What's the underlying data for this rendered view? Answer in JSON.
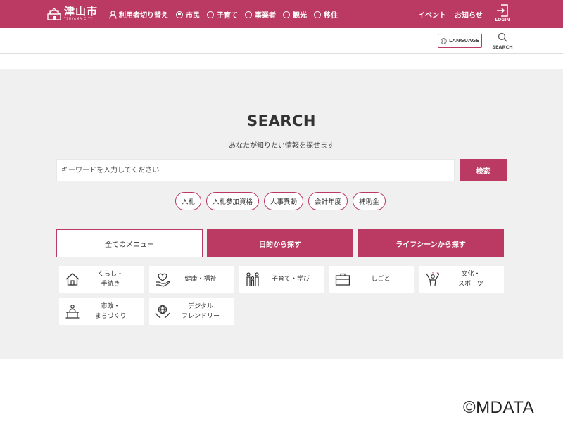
{
  "header": {
    "logo_text": "津山市",
    "logo_sub": "TSUYAMA CITY",
    "user_switch_label": "利用者切り替え",
    "user_types": [
      {
        "label": "市民",
        "checked": true
      },
      {
        "label": "子育て",
        "checked": false
      },
      {
        "label": "事業者",
        "checked": false
      },
      {
        "label": "観光",
        "checked": false
      },
      {
        "label": "移住",
        "checked": false
      }
    ],
    "links": [
      "イベント",
      "お知らせ"
    ],
    "login_label": "LOGIN",
    "language_label": "LANGUAGE",
    "search_label": "SEARCH"
  },
  "search": {
    "title": "SEARCH",
    "subtitle": "あなたが知りたい情報を探せます",
    "placeholder": "キーワードを入力してください",
    "button_label": "検索",
    "tags": [
      "入札",
      "入札参加資格",
      "人事異動",
      "会計年度",
      "補助金"
    ]
  },
  "tabs": [
    {
      "label": "全てのメニュー",
      "active": true
    },
    {
      "label": "目的から探す",
      "active": false
    },
    {
      "label": "ライフシーンから探す",
      "active": false
    }
  ],
  "menu": [
    {
      "label": "くらし・\n手続き",
      "icon": "house-icon"
    },
    {
      "label": "健康・福祉",
      "icon": "heart-hand-icon"
    },
    {
      "label": "子育て・学び",
      "icon": "family-icon"
    },
    {
      "label": "しごと",
      "icon": "briefcase-icon"
    },
    {
      "label": "文化・\nスポーツ",
      "icon": "cheer-icon"
    },
    {
      "label": "市政・\nまちづくり",
      "icon": "podium-icon"
    },
    {
      "label": "デジタル\nフレンドリー",
      "icon": "globe-hand-icon"
    }
  ],
  "watermark": "©MDATA",
  "colors": {
    "brand": "#bb3a64",
    "background": "#f0f0f0"
  }
}
